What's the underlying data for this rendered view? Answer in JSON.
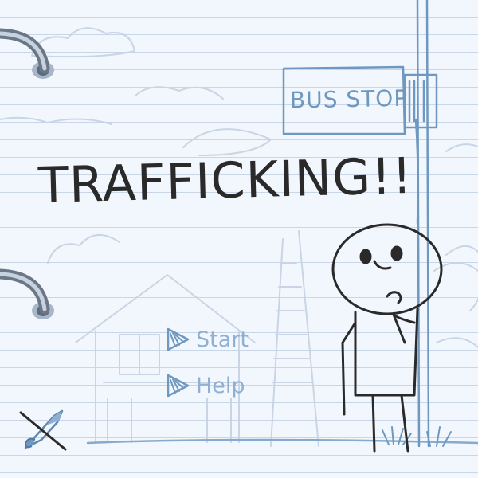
{
  "game": {
    "title": "TRAFFICKING!!",
    "sign_text": "BUS STOP"
  },
  "menu": {
    "items": [
      {
        "label": "Start"
      },
      {
        "label": "Help"
      }
    ]
  },
  "icons": {
    "menu_arrow": "play-arrow-icon",
    "sound": "sound-muted-icon",
    "binder": "binder-ring-icon"
  },
  "colors": {
    "paper": "#f2f7fe",
    "rule_line": "#c9d6e8",
    "ink_dark": "#2a2a2a",
    "ink_blue": "#6e98c0",
    "ink_faint": "#c5d2e2"
  }
}
